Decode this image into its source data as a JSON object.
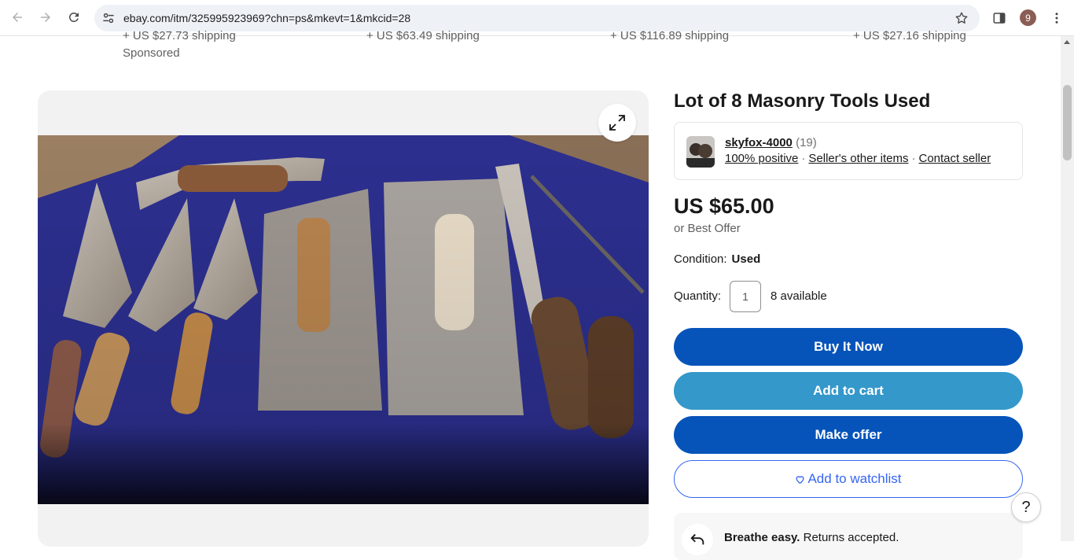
{
  "browser": {
    "url": "ebay.com/itm/325995923969?chn=ps&mkevt=1&mkcid=28",
    "profile_initial": "9"
  },
  "carousel": {
    "shipping": [
      "+ US $27.73 shipping",
      "+ US $63.49 shipping",
      "+ US $116.89 shipping",
      "+ US $27.16 shipping"
    ],
    "sponsored": "Sponsored"
  },
  "listing": {
    "title": "Lot of 8 Masonry Tools Used",
    "seller": {
      "name": "skyfox-4000",
      "feedback_count": "(19)",
      "positive": "100% positive",
      "other_items": "Seller's other items",
      "contact": "Contact seller"
    },
    "price": "US $65.00",
    "best_offer": "or Best Offer",
    "condition_label": "Condition:",
    "condition_value": "Used",
    "quantity_label": "Quantity:",
    "quantity_value": "1",
    "available": "8 available",
    "buttons": {
      "buy_now": "Buy It Now",
      "add_to_cart": "Add to cart",
      "make_offer": "Make offer",
      "watchlist": "Add to watchlist"
    },
    "returns": {
      "bold": "Breathe easy.",
      "text": " Returns accepted."
    }
  },
  "help": "?",
  "colors": {
    "primary_blue": "#0654ba",
    "cart_blue": "#3498ca",
    "link_blue": "#3665f3"
  }
}
